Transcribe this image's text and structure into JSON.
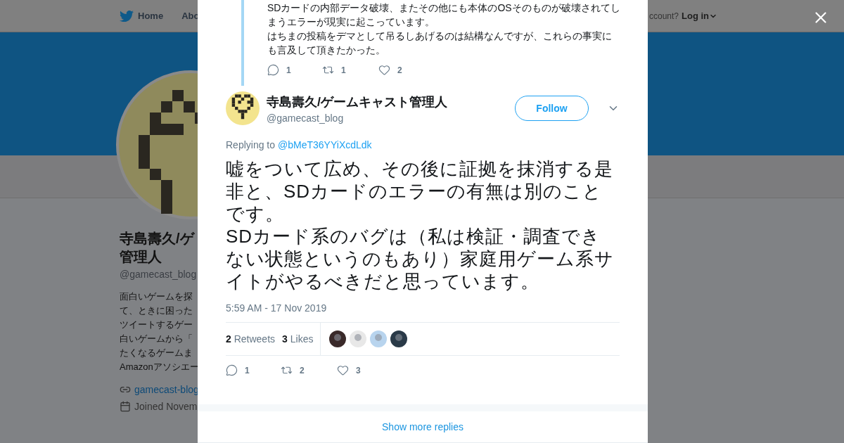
{
  "background_page": {
    "nav": {
      "items": [
        {
          "label": "Home",
          "kind": "home"
        },
        {
          "label": "Abo",
          "kind": "plain"
        }
      ],
      "account_prompt": "ccount?",
      "login": "Log in"
    },
    "profile": {
      "name_lines": [
        "寺島壽久/ゲ",
        "管理人"
      ],
      "handle": "@gamecast_blog",
      "bio_lines": [
        "面白いゲームを探",
        "て、ときに困った",
        "ツイートするゲー",
        "白いゲームから「",
        "たくなるゲームま",
        "Amazonアソシエー"
      ],
      "website": "gamecast-blog",
      "joined": "Joined Novem"
    }
  },
  "modal": {
    "previous_tweet": {
      "text_lines": [
        "SDカードの内部データ破壊、またその他にも本体のOSそのものが破壊されてし",
        "まうエラーが現実に起こっています。",
        "はちまの投稿をデマとして吊るしあげるのは結構なんですが、これらの事実に",
        "も言及して頂きたかった。"
      ],
      "actions": [
        {
          "kind": "reply",
          "count": "1"
        },
        {
          "kind": "retweet",
          "count": "1"
        },
        {
          "kind": "like",
          "count": "2"
        }
      ]
    },
    "tweet": {
      "name": "寺島壽久/ゲームキャスト管理人",
      "handle": "@gamecast_blog",
      "follow_label": "Follow",
      "replying_prefix": "Replying to",
      "replying_to": "@bMeT36YYiXcdLdk",
      "paragraphs": [
        "嘘をついて広め、その後に証拠を抹消する是非と、SDカードのエラーの有無は別のことです。",
        "SDカード系のバグは（私は検証・調査できない状態というのもあり）家庭用ゲーム系サイトがやるべきだと思っています。"
      ],
      "timestamp": "5:59 AM - 17 Nov 2019",
      "stats": [
        {
          "count": "2",
          "label": "Retweets"
        },
        {
          "count": "3",
          "label": "Likes"
        }
      ],
      "likers": [
        {
          "color": "#3a2a2a"
        },
        {
          "color": "#e8e8e8"
        },
        {
          "color": "#b8d4ee"
        },
        {
          "color": "#2a3a48"
        }
      ],
      "actions": [
        {
          "kind": "reply",
          "count": "1"
        },
        {
          "kind": "retweet",
          "count": "2"
        },
        {
          "kind": "like",
          "count": "3"
        }
      ]
    },
    "show_more": "Show more replies"
  }
}
